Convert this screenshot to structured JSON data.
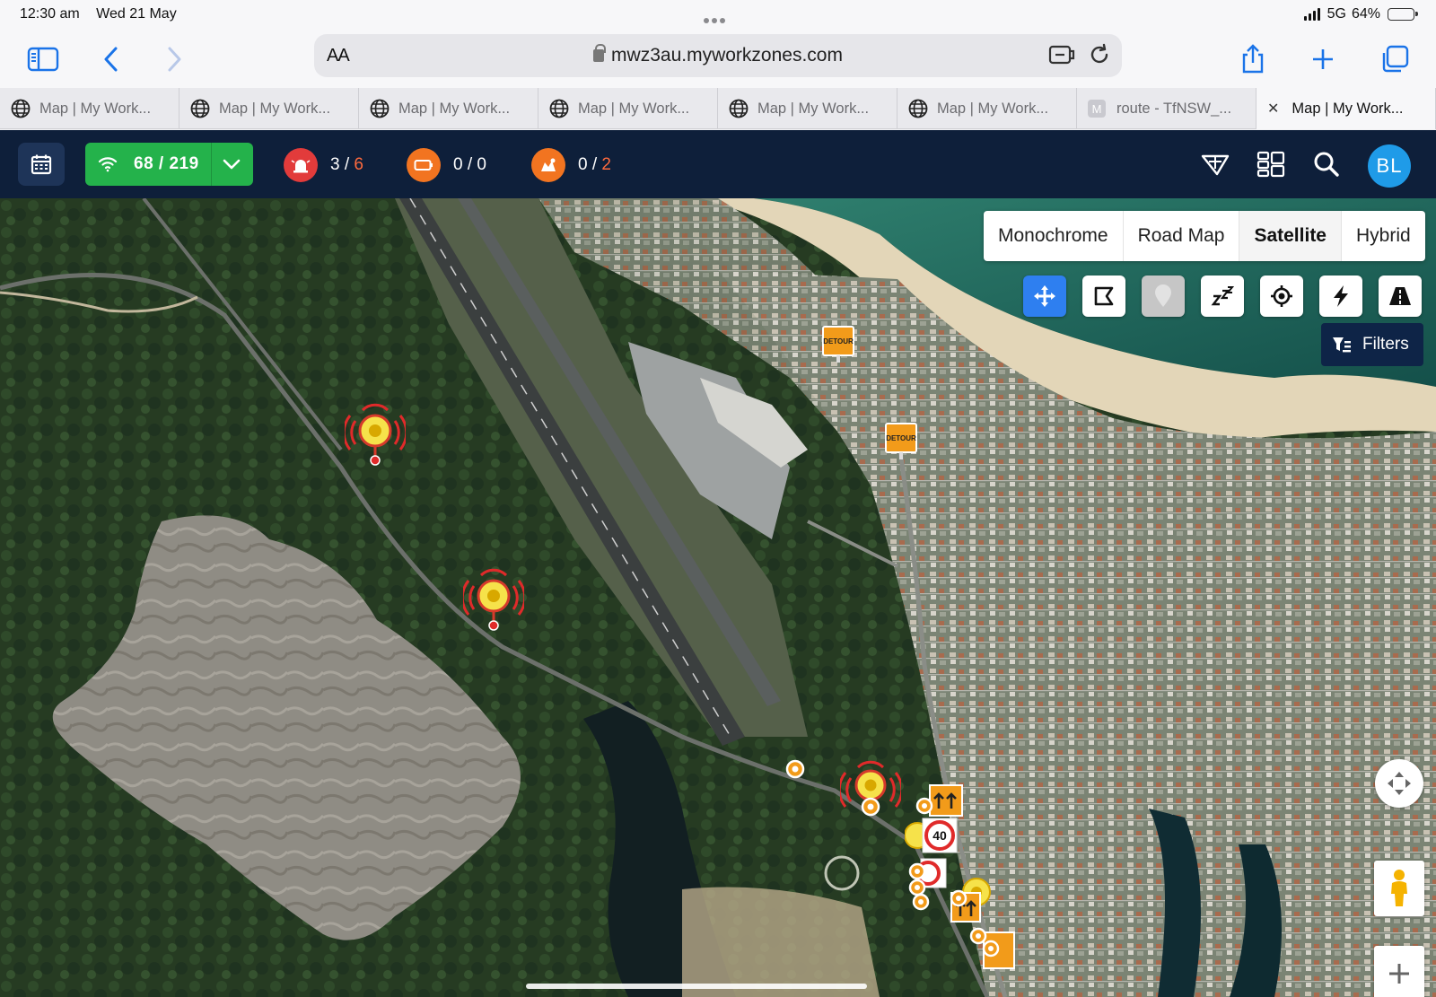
{
  "status_bar": {
    "time": "12:30 am",
    "date": "Wed 21 May",
    "network": "5G",
    "battery": "64%",
    "battery_level": 0.64
  },
  "browser": {
    "text_size_label": "AA",
    "url": "mwz3au.myworkzones.com",
    "tabs": [
      {
        "title": "Map | My Work...",
        "icon": "globe-icon",
        "active": false
      },
      {
        "title": "Map | My Work...",
        "icon": "globe-icon",
        "active": false
      },
      {
        "title": "Map | My Work...",
        "icon": "globe-icon",
        "active": false
      },
      {
        "title": "Map | My Work...",
        "icon": "globe-icon",
        "active": false
      },
      {
        "title": "Map | My Work...",
        "icon": "globe-icon",
        "active": false
      },
      {
        "title": "Map | My Work...",
        "icon": "globe-icon",
        "active": false
      },
      {
        "title": "route - TfNSW_...",
        "icon": "m-favicon",
        "favicon_letter": "M",
        "active": false
      },
      {
        "title": "Map | My Work...",
        "icon": "close-icon",
        "active": true
      }
    ]
  },
  "app_header": {
    "online": {
      "current": "68",
      "total": "219",
      "label": "68 / 219"
    },
    "stats": [
      {
        "name": "alerts",
        "current": "3",
        "separator": " / ",
        "total": "6",
        "color": "#e23b3b"
      },
      {
        "name": "batteries",
        "current": "0",
        "separator": " / ",
        "total": "0",
        "color": "#f27420"
      },
      {
        "name": "incidents",
        "current": "0",
        "separator": " / ",
        "total": "2",
        "color": "#f27420"
      }
    ],
    "avatar_initials": "BL",
    "colors": {
      "header_bg": "#0e1f3a",
      "online_green": "#24b24b",
      "avatar": "#1f9be8",
      "alert_red": "#e23b3b",
      "orange": "#f27420"
    }
  },
  "map": {
    "map_types": [
      "Monochrome",
      "Road Map",
      "Satellite",
      "Hybrid"
    ],
    "selected_map_type": "Satellite",
    "tools": [
      "move-icon",
      "polygon-icon",
      "pin-icon",
      "sleep-icon",
      "locate-icon",
      "lightning-icon",
      "road-icon"
    ],
    "filters_label": "Filters",
    "detour_signs": [
      "DETOUR",
      "DETOUR"
    ],
    "speed_sign": "40"
  }
}
